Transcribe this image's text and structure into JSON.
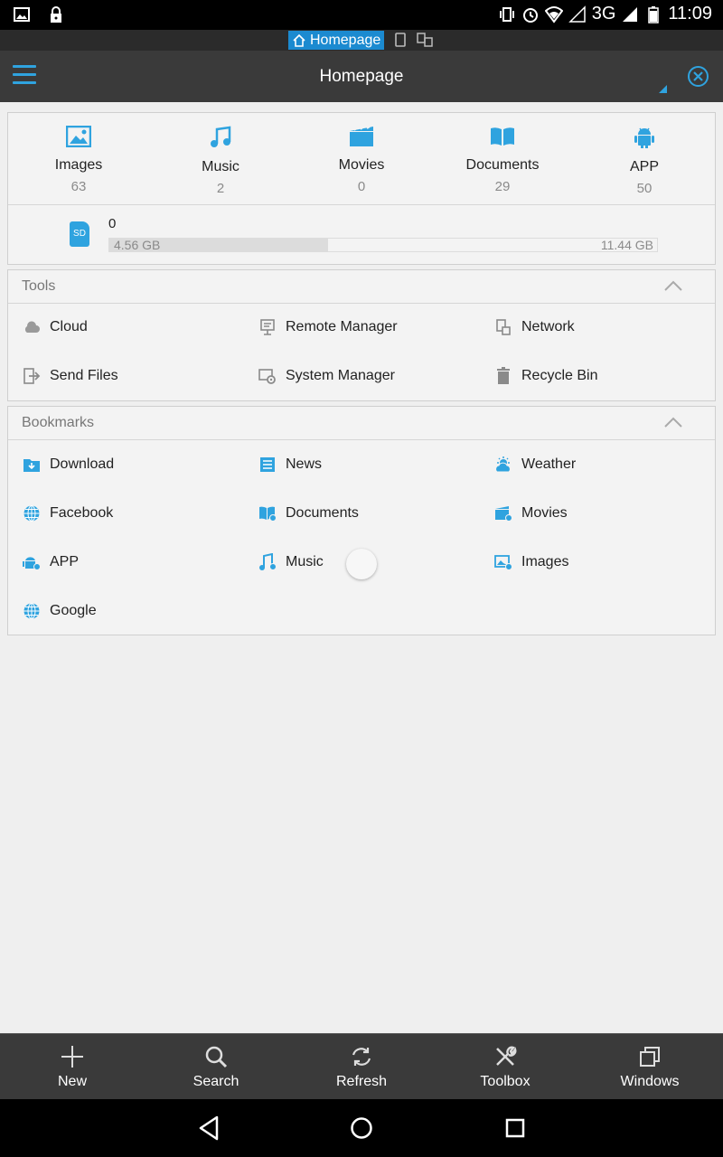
{
  "status_bar": {
    "time": "11:09",
    "network": "3G",
    "icons": [
      "image-icon",
      "lock-icon",
      "vibrate-icon",
      "alarm-icon",
      "wifi-icon",
      "signal-icon",
      "battery-icon"
    ]
  },
  "tab_strip": {
    "active_tab": "Homepage",
    "icons": [
      "home-icon",
      "phone-icon",
      "devices-icon"
    ]
  },
  "action_bar": {
    "title": "Homepage",
    "icons": [
      "menu-icon",
      "close-circle-icon"
    ]
  },
  "categories": [
    {
      "label": "Images",
      "count": "63",
      "icon": "image-icon"
    },
    {
      "label": "Music",
      "count": "2",
      "icon": "music-icon"
    },
    {
      "label": "Movies",
      "count": "0",
      "icon": "movie-icon"
    },
    {
      "label": "Documents",
      "count": "29",
      "icon": "book-icon"
    },
    {
      "label": "APP",
      "count": "50",
      "icon": "android-icon"
    }
  ],
  "storage": {
    "badge": "SD",
    "name": "0",
    "used": "4.56 GB",
    "total": "11.44 GB",
    "used_fraction": 0.4
  },
  "tools": {
    "title": "Tools",
    "items": [
      {
        "label": "Cloud",
        "icon": "cloud-icon"
      },
      {
        "label": "Remote Manager",
        "icon": "remote-manager-icon"
      },
      {
        "label": "Network",
        "icon": "network-icon"
      },
      {
        "label": "Send Files",
        "icon": "send-files-icon"
      },
      {
        "label": "System Manager",
        "icon": "system-manager-icon"
      },
      {
        "label": "Recycle Bin",
        "icon": "trash-icon"
      }
    ]
  },
  "bookmarks": {
    "title": "Bookmarks",
    "items": [
      {
        "label": "Download",
        "icon": "download-folder-icon"
      },
      {
        "label": "News",
        "icon": "news-icon"
      },
      {
        "label": "Weather",
        "icon": "weather-icon"
      },
      {
        "label": "Facebook",
        "icon": "globe-icon"
      },
      {
        "label": "Documents",
        "icon": "documents-icon"
      },
      {
        "label": "Movies",
        "icon": "movies-icon"
      },
      {
        "label": "APP",
        "icon": "app-icon"
      },
      {
        "label": "Music",
        "icon": "music-icon"
      },
      {
        "label": "Images",
        "icon": "images-icon"
      },
      {
        "label": "Google",
        "icon": "globe-icon"
      }
    ]
  },
  "toolbar": {
    "items": [
      {
        "label": "New",
        "icon": "plus-icon"
      },
      {
        "label": "Search",
        "icon": "search-icon"
      },
      {
        "label": "Refresh",
        "icon": "refresh-icon"
      },
      {
        "label": "Toolbox",
        "icon": "tools-icon"
      },
      {
        "label": "Windows",
        "icon": "windows-icon"
      }
    ]
  },
  "colors": {
    "accent": "#2fa3df",
    "bar": "#3a3a3a",
    "background": "#efefef",
    "tab_highlight": "#1b8ad0"
  }
}
